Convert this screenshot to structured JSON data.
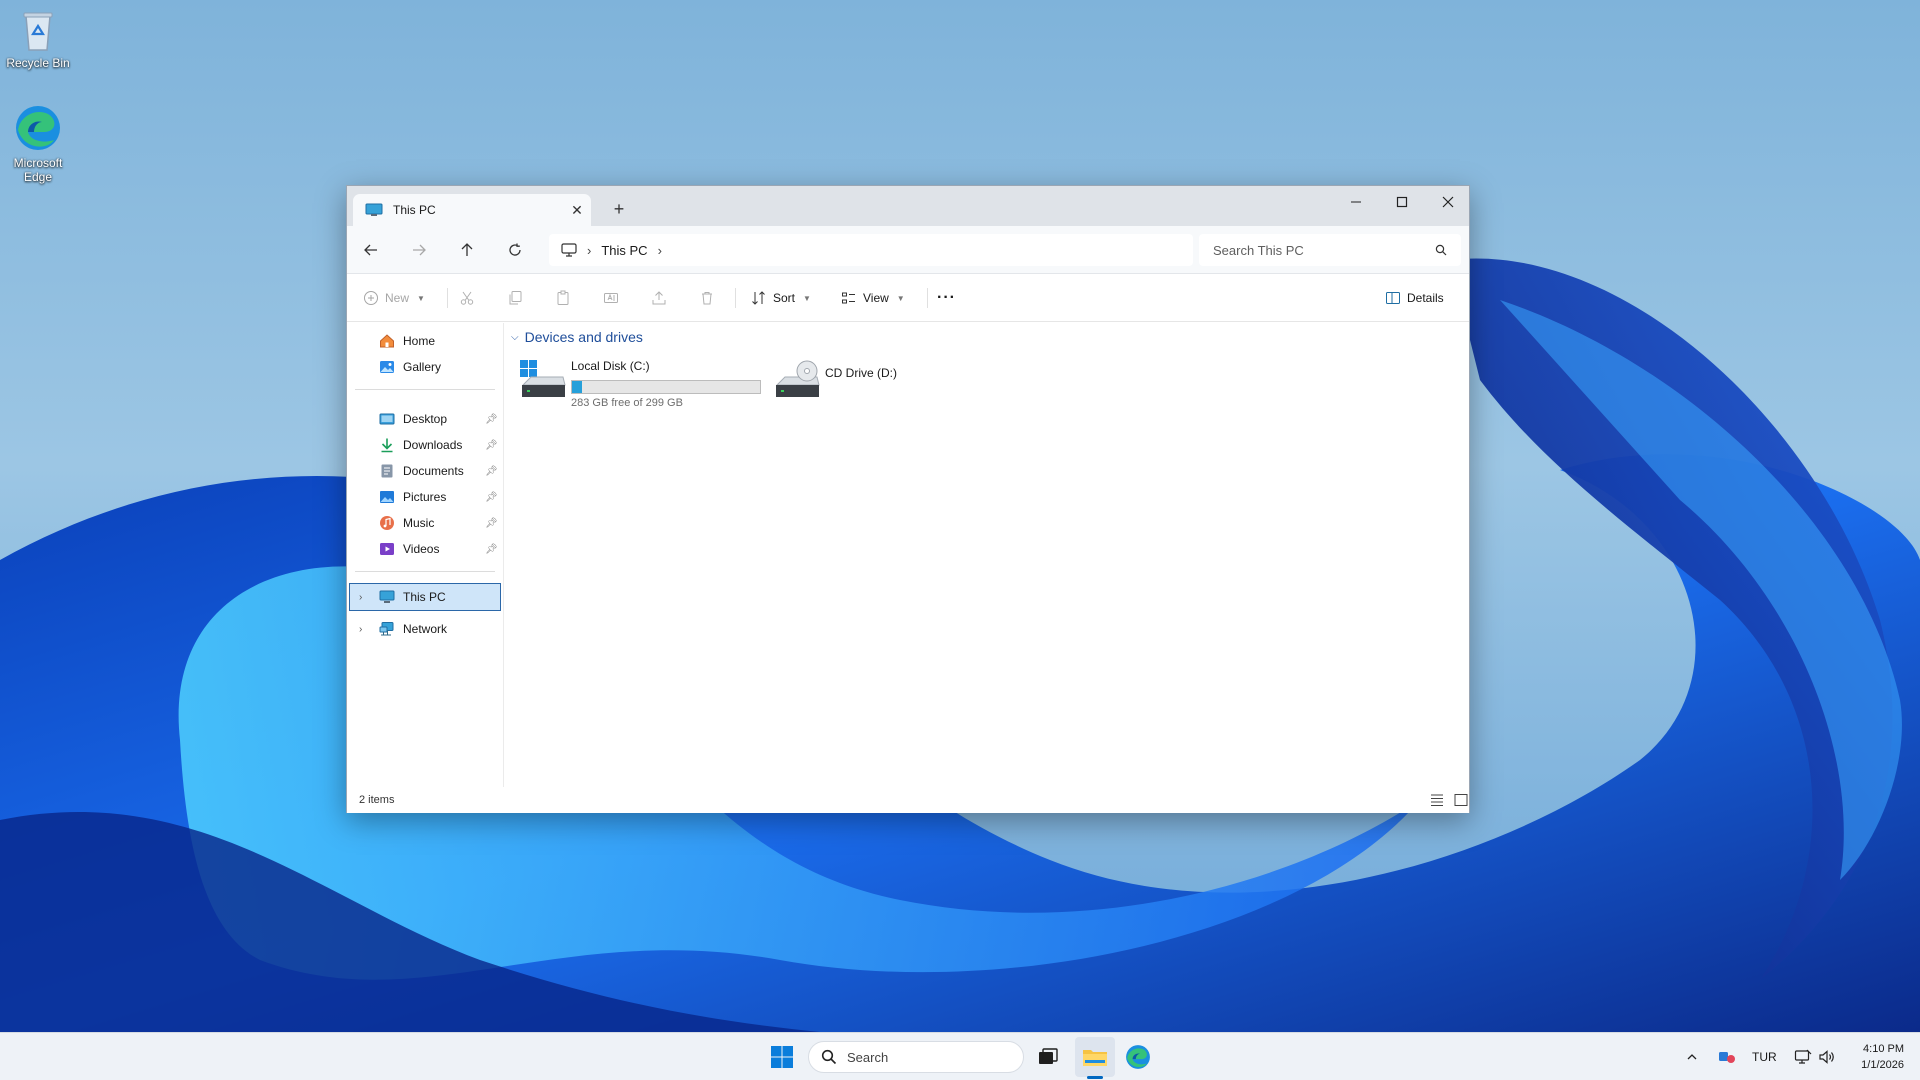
{
  "desktop": {
    "icons": [
      {
        "label": "Recycle Bin",
        "icon": "recycle-bin-icon"
      },
      {
        "label": "Microsoft Edge",
        "icon": "edge-icon"
      }
    ]
  },
  "window": {
    "tab_title": "This PC",
    "new_tab_label": "+",
    "controls": {
      "minimize": "minimize-icon",
      "maximize": "maximize-icon",
      "close": "close-icon"
    }
  },
  "nav": {
    "breadcrumb": [
      "This PC"
    ],
    "search_placeholder": "Search This PC"
  },
  "toolbar": {
    "new_label": "New",
    "sort_label": "Sort",
    "view_label": "View",
    "more_label": "···",
    "details_label": "Details"
  },
  "sidebar": {
    "items": [
      {
        "label": "Home",
        "icon": "home-icon"
      },
      {
        "label": "Gallery",
        "icon": "gallery-icon"
      },
      {
        "label": "Desktop",
        "icon": "desktop-folder-icon",
        "pinned": true
      },
      {
        "label": "Downloads",
        "icon": "downloads-icon",
        "pinned": true
      },
      {
        "label": "Documents",
        "icon": "documents-icon",
        "pinned": true
      },
      {
        "label": "Pictures",
        "icon": "pictures-icon",
        "pinned": true
      },
      {
        "label": "Music",
        "icon": "music-icon",
        "pinned": true
      },
      {
        "label": "Videos",
        "icon": "videos-icon",
        "pinned": true
      },
      {
        "label": "This PC",
        "icon": "this-pc-icon",
        "selected": true
      },
      {
        "label": "Network",
        "icon": "network-icon"
      }
    ]
  },
  "content": {
    "group_label": "Devices and drives",
    "drives": [
      {
        "name": "Local Disk (C:)",
        "free_text": "283 GB free of 299 GB",
        "used_fraction": 0.054,
        "icon": "local-disk-icon"
      },
      {
        "name": "CD Drive (D:)",
        "icon": "cd-drive-icon"
      }
    ]
  },
  "status": {
    "item_count": "2 items"
  },
  "taskbar": {
    "search_placeholder": "Search",
    "language": "TUR",
    "time": "4:10 PM",
    "date": "1/1/2026"
  },
  "colors": {
    "accent": "#0067c0",
    "selection": "#cfe5f9",
    "drive_bar": "#26a0da",
    "group_header": "#1f4e9a"
  }
}
